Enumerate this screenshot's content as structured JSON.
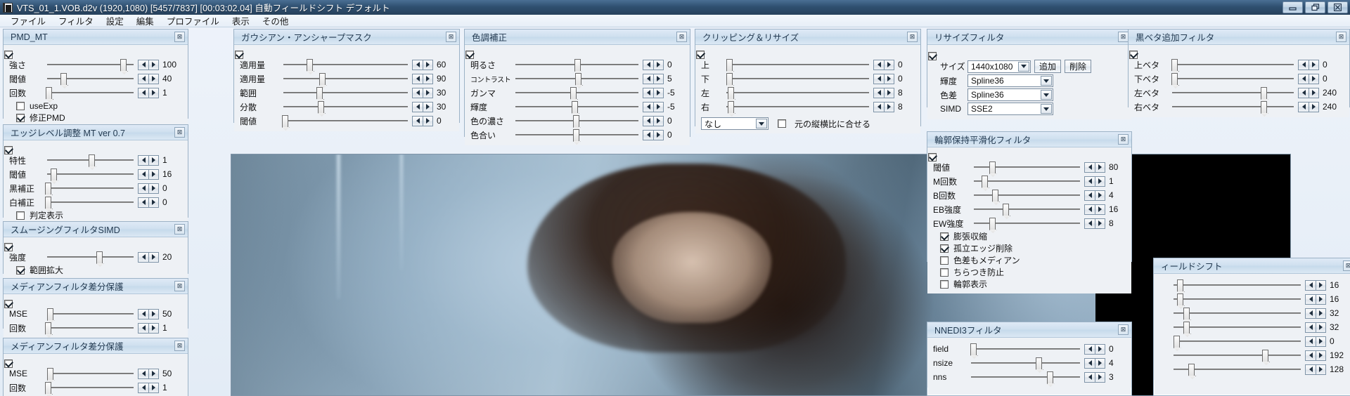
{
  "window": {
    "title": "VTS_01_1.VOB.d2v (1920,1080)  [5457/7837] [00:03:02.04] 自動フィールドシフト デフォルト",
    "minimize_label": "minimize",
    "restore_label": "restore",
    "close_label": "close"
  },
  "menu": {
    "items": [
      {
        "label": "ファイル"
      },
      {
        "label": "フィルタ"
      },
      {
        "label": "設定"
      },
      {
        "label": "編集"
      },
      {
        "label": "プロファイル"
      },
      {
        "label": "表示"
      },
      {
        "label": "その他"
      }
    ]
  },
  "panels": {
    "pmd_mt": {
      "title": "PMD_MT",
      "close": "⊠",
      "enabled": true,
      "rows": [
        {
          "label": "強さ",
          "value": "100",
          "pos": 88
        },
        {
          "label": "閾値",
          "value": "40",
          "pos": 19
        },
        {
          "label": "回数",
          "value": "1",
          "pos": 2
        }
      ],
      "checks": [
        {
          "label": "useExp",
          "checked": false
        },
        {
          "label": "修正PMD",
          "checked": true
        }
      ]
    },
    "edge_level": {
      "title": "エッジレベル調整 MT ver 0.7",
      "close": "⊠",
      "enabled": true,
      "rows": [
        {
          "label": "特性",
          "value": "1",
          "pos": 51
        },
        {
          "label": "閾値",
          "value": "16",
          "pos": 7
        },
        {
          "label": "黒補正",
          "value": "0",
          "pos": 1
        },
        {
          "label": "白補正",
          "value": "0",
          "pos": 1
        }
      ],
      "checks": [
        {
          "label": "判定表示",
          "checked": false
        }
      ]
    },
    "smoothing": {
      "title": "スムージングフィルタSIMD",
      "close": "⊠",
      "enabled": true,
      "rows": [
        {
          "label": "強度",
          "value": "20",
          "pos": 60
        }
      ],
      "checks": [
        {
          "label": "範囲拡大",
          "checked": true
        }
      ]
    },
    "median": {
      "title": "メディアンフィルタ差分保護",
      "close": "⊠",
      "enabled": true,
      "rows": [
        {
          "label": "MSE",
          "value": "50",
          "pos": 3
        },
        {
          "label": "回数",
          "value": "1",
          "pos": 1
        }
      ],
      "checks": []
    },
    "gaussian": {
      "title": "ガウシアン・アンシャープマスク",
      "close": "⊠",
      "enabled": true,
      "rows": [
        {
          "label": "適用量",
          "value": "60",
          "pos": 21
        },
        {
          "label": "適用量",
          "value": "90",
          "pos": 31
        },
        {
          "label": "範囲",
          "value": "30",
          "pos": 29
        },
        {
          "label": "分散",
          "value": "30",
          "pos": 30
        },
        {
          "label": "閾値",
          "value": "0",
          "pos": 1
        }
      ],
      "checks": []
    },
    "tone": {
      "title": "色調補正",
      "close": "⊠",
      "enabled": true,
      "rows": [
        {
          "label": "明るさ",
          "value": "0",
          "pos": 50,
          "small": false
        },
        {
          "label": "コントラスト",
          "value": "5",
          "pos": 51,
          "small": true
        },
        {
          "label": "ガンマ",
          "value": "-5",
          "pos": 47,
          "small": false
        },
        {
          "label": "輝度",
          "value": "-5",
          "pos": 48,
          "small": false
        },
        {
          "label": "色の濃さ",
          "value": "0",
          "pos": 49,
          "small": false
        },
        {
          "label": "色合い",
          "value": "0",
          "pos": 49,
          "small": false
        }
      ],
      "checks": []
    },
    "clipping": {
      "title": "クリッピング＆リサイズ",
      "close": "⊠",
      "enabled": true,
      "rows": [
        {
          "label": "上",
          "value": "0",
          "pos": 2
        },
        {
          "label": "下",
          "value": "0",
          "pos": 2
        },
        {
          "label": "左",
          "value": "8",
          "pos": 3
        },
        {
          "label": "右",
          "value": "8",
          "pos": 3
        }
      ],
      "select_value": "なし",
      "aspect_label": "元の縦横比に合せる",
      "aspect_checked": false
    },
    "resize": {
      "title": "リサイズフィルタ",
      "close": "⊠",
      "enabled": true,
      "size_label": "サイズ",
      "size_value": "1440x1080",
      "add_label": "追加",
      "del_label": "削除",
      "fields": [
        {
          "label": "輝度",
          "value": "Spline36"
        },
        {
          "label": "色差",
          "value": "Spline36"
        },
        {
          "label": "SIMD",
          "value": "SSE2"
        }
      ]
    },
    "edge_preserve": {
      "title": "輪郭保持平滑化フィルタ",
      "close": "⊠",
      "enabled": true,
      "rows": [
        {
          "label": "閾値",
          "value": "80",
          "pos": 17
        },
        {
          "label": "M回数",
          "value": "1",
          "pos": 10
        },
        {
          "label": "B回数",
          "value": "4",
          "pos": 20
        },
        {
          "label": "EB強度",
          "value": "16",
          "pos": 30
        },
        {
          "label": "EW強度",
          "value": "8",
          "pos": 17
        }
      ],
      "checks": [
        {
          "label": "膨張収縮",
          "checked": true
        },
        {
          "label": "孤立エッジ削除",
          "checked": true
        },
        {
          "label": "色差もメディアン",
          "checked": false
        },
        {
          "label": "ちらつき防止",
          "checked": false
        },
        {
          "label": "輪郭表示",
          "checked": false
        }
      ]
    },
    "nnedi3": {
      "title": "NNEDI3フィルタ",
      "close": "⊠",
      "enabled": true,
      "rows": [
        {
          "label": "field",
          "value": "0",
          "pos": 2
        },
        {
          "label": "nsize",
          "value": "4",
          "pos": 62
        },
        {
          "label": "nns",
          "value": "3",
          "pos": 72
        }
      ]
    },
    "black_bar": {
      "title": "黒ベタ追加フィルタ",
      "close": "⊠",
      "enabled": true,
      "rows": [
        {
          "label": "上ベタ",
          "value": "0",
          "pos": 2
        },
        {
          "label": "下ベタ",
          "value": "0",
          "pos": 2
        },
        {
          "label": "左ベタ",
          "value": "240",
          "pos": 75
        },
        {
          "label": "右ベタ",
          "value": "240",
          "pos": 75
        }
      ]
    },
    "field_shift": {
      "title": "ィールドシフト",
      "close": "⊠",
      "enabled": true,
      "rows": [
        {
          "label": "",
          "value": "16",
          "pos": 5
        },
        {
          "label": "",
          "value": "16",
          "pos": 5
        },
        {
          "label": "",
          "value": "32",
          "pos": 10
        },
        {
          "label": "",
          "value": "32",
          "pos": 10
        },
        {
          "label": "",
          "value": "0",
          "pos": 2
        },
        {
          "label": "",
          "value": "192",
          "pos": 72
        },
        {
          "label": "",
          "value": "128",
          "pos": 14
        }
      ]
    }
  },
  "colors": {
    "titlebar_from": "#4a6f94",
    "titlebar_to": "#27415c",
    "panel_header": "#cfe0ef",
    "panel_bg": "#eef1f5",
    "panel_border": "#9cb2c6",
    "text": "#111111",
    "title_text": "#243b52"
  }
}
